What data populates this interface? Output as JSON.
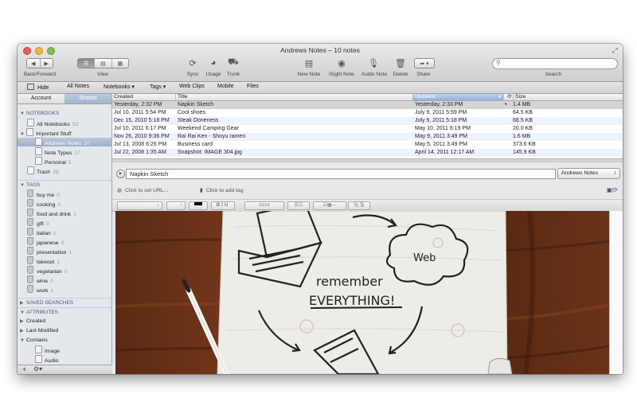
{
  "window": {
    "title": "Andrews Notes – 10 notes"
  },
  "toolbar": {
    "back_forward_label": "Back/Forward",
    "view_label": "View",
    "sync_label": "Sync",
    "usage_label": "Usage",
    "trunk_label": "Trunk",
    "new_note_label": "New Note",
    "isight_note_label": "iSight Note",
    "audio_note_label": "Audio Note",
    "delete_label": "Delete",
    "share_label": "Share",
    "search_label": "Search",
    "search_placeholder": ""
  },
  "navbar": {
    "hide": "Hide",
    "all_notes": "All Notes",
    "notebooks": "Notebooks",
    "tags": "Tags",
    "web_clips": "Web Clips",
    "mobile": "Mobile",
    "files": "Files"
  },
  "sidebar": {
    "tabs": {
      "account": "Account",
      "shared": "Shared"
    },
    "notebooks_header": "NOTEBOOKS",
    "notebooks": [
      {
        "label": "All Notebooks",
        "count": "52"
      },
      {
        "label": "Important Stuff",
        "count": ""
      },
      {
        "label": "Andrews Notes",
        "count": "10"
      },
      {
        "label": "Note Types",
        "count": "17"
      },
      {
        "label": "Personal",
        "count": "5"
      },
      {
        "label": "Trash",
        "count": "28"
      }
    ],
    "tags_header": "TAGS",
    "tags": [
      {
        "label": "buy me",
        "count": "0"
      },
      {
        "label": "cooking",
        "count": "2"
      },
      {
        "label": "food and drink",
        "count": "1"
      },
      {
        "label": "gift",
        "count": "0"
      },
      {
        "label": "italian",
        "count": "1"
      },
      {
        "label": "japanese",
        "count": "0"
      },
      {
        "label": "presentation",
        "count": "1"
      },
      {
        "label": "takeout",
        "count": "1"
      },
      {
        "label": "vegetarian",
        "count": "0"
      },
      {
        "label": "wine",
        "count": "0"
      },
      {
        "label": "work",
        "count": "1"
      }
    ],
    "saved_searches_header": "SAVED SEARCHES",
    "attributes_header": "ATTRIBUTES",
    "attributes": [
      "Created",
      "Last Modified",
      "Contains",
      "Image",
      "Audio"
    ]
  },
  "note_list": {
    "columns": {
      "created": "Created",
      "title": "Title",
      "updated": "Updated",
      "size": "Size"
    },
    "rows": [
      {
        "created": "Yesterday, 2:32 PM",
        "title": "Napkin Sketch",
        "updated": "Yesterday, 2:33 PM",
        "size": "1.4 MB"
      },
      {
        "created": "Jul 10, 2011 5:54 PM",
        "title": "Cool shoes",
        "updated": "July 9, 2011 5:59 PM",
        "size": "64.5 KB"
      },
      {
        "created": "Dec 15, 2010 5:18 PM",
        "title": "Steak Doneness",
        "updated": "July 9, 2011 5:18 PM",
        "size": "68.5 KB"
      },
      {
        "created": "Jul 10, 2011 6:17 PM",
        "title": "Weekend Camping Gear",
        "updated": "May 10, 2011 6:19 PM",
        "size": "20.0 KB"
      },
      {
        "created": "Nov 26, 2010 9:36 PM",
        "title": "Rai Rai Ken - Shoyu ramen",
        "updated": "May 9, 2011 3:49 PM",
        "size": "1.6 MB"
      },
      {
        "created": "Jul 13, 2008 6:26 PM",
        "title": "Business card",
        "updated": "May 5, 2011 3:49 PM",
        "size": "373.6 KB"
      },
      {
        "created": "Jul 22, 2008 1:35 AM",
        "title": "Snapshot: IMAGE 304.jpg",
        "updated": "April 14, 2011 12:17 AM",
        "size": "145.9 KB"
      }
    ]
  },
  "editor": {
    "note_title": "Napkin Sketch",
    "notebook": "Andrews Notes",
    "url_placeholder": "Click to set URL...",
    "tag_placeholder": "Click to add tag"
  },
  "image": {
    "description_text": [
      "Web",
      "remember",
      "EVERYTHING!"
    ]
  },
  "colors": {
    "selection": "#9fb1c9",
    "updated_header": "#8fb2dd",
    "close": "#ec5f5a",
    "minimize": "#f0b640",
    "zoom": "#7ec04f"
  }
}
